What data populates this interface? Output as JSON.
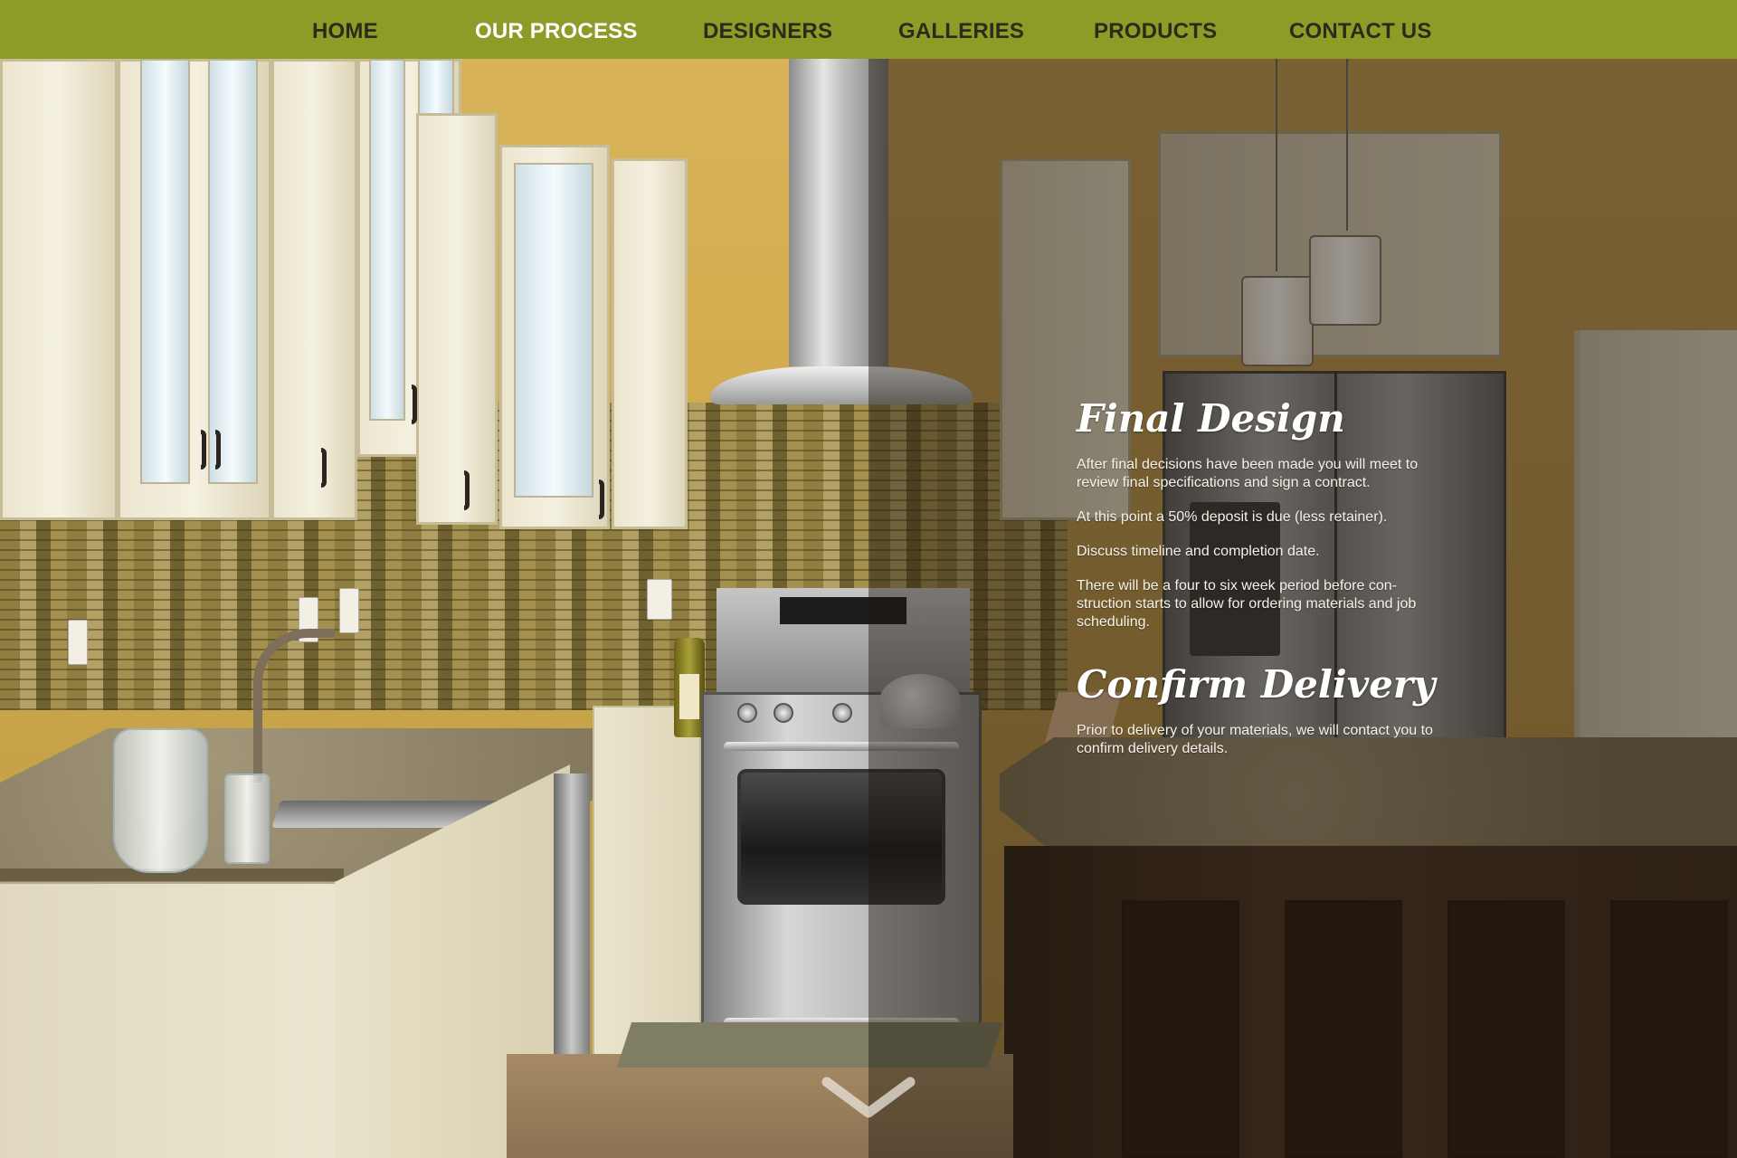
{
  "nav": {
    "items": [
      {
        "label": "HOME",
        "active": false
      },
      {
        "label": "OUR PROCESS",
        "active": true
      },
      {
        "label": "DESIGNERS",
        "active": false
      },
      {
        "label": "GALLERIES",
        "active": false
      },
      {
        "label": "PRODUCTS",
        "active": false
      },
      {
        "label": "CONTACT US",
        "active": false
      }
    ],
    "colors": {
      "background": "#8f9b27",
      "text": "#2b2b1a",
      "active_text": "#ffffff"
    }
  },
  "content": {
    "sections": [
      {
        "heading": "Final Design",
        "paragraphs": [
          "After final decisions have been made you will meet to review final specifications and sign a contract.",
          "At this point a 50% deposit is due (less retainer).",
          "Discuss timeline and completion date.",
          "There will be a four to six week period before con-struction starts to allow for ordering materials and job scheduling."
        ]
      },
      {
        "heading": "Confirm Delivery",
        "paragraphs": [
          "Prior to delivery of your materials, we will contact you to confirm delivery details."
        ]
      }
    ]
  },
  "scroll_indicator": {
    "icon": "chevron-down-icon"
  },
  "background": {
    "image": "kitchen-illustration"
  }
}
